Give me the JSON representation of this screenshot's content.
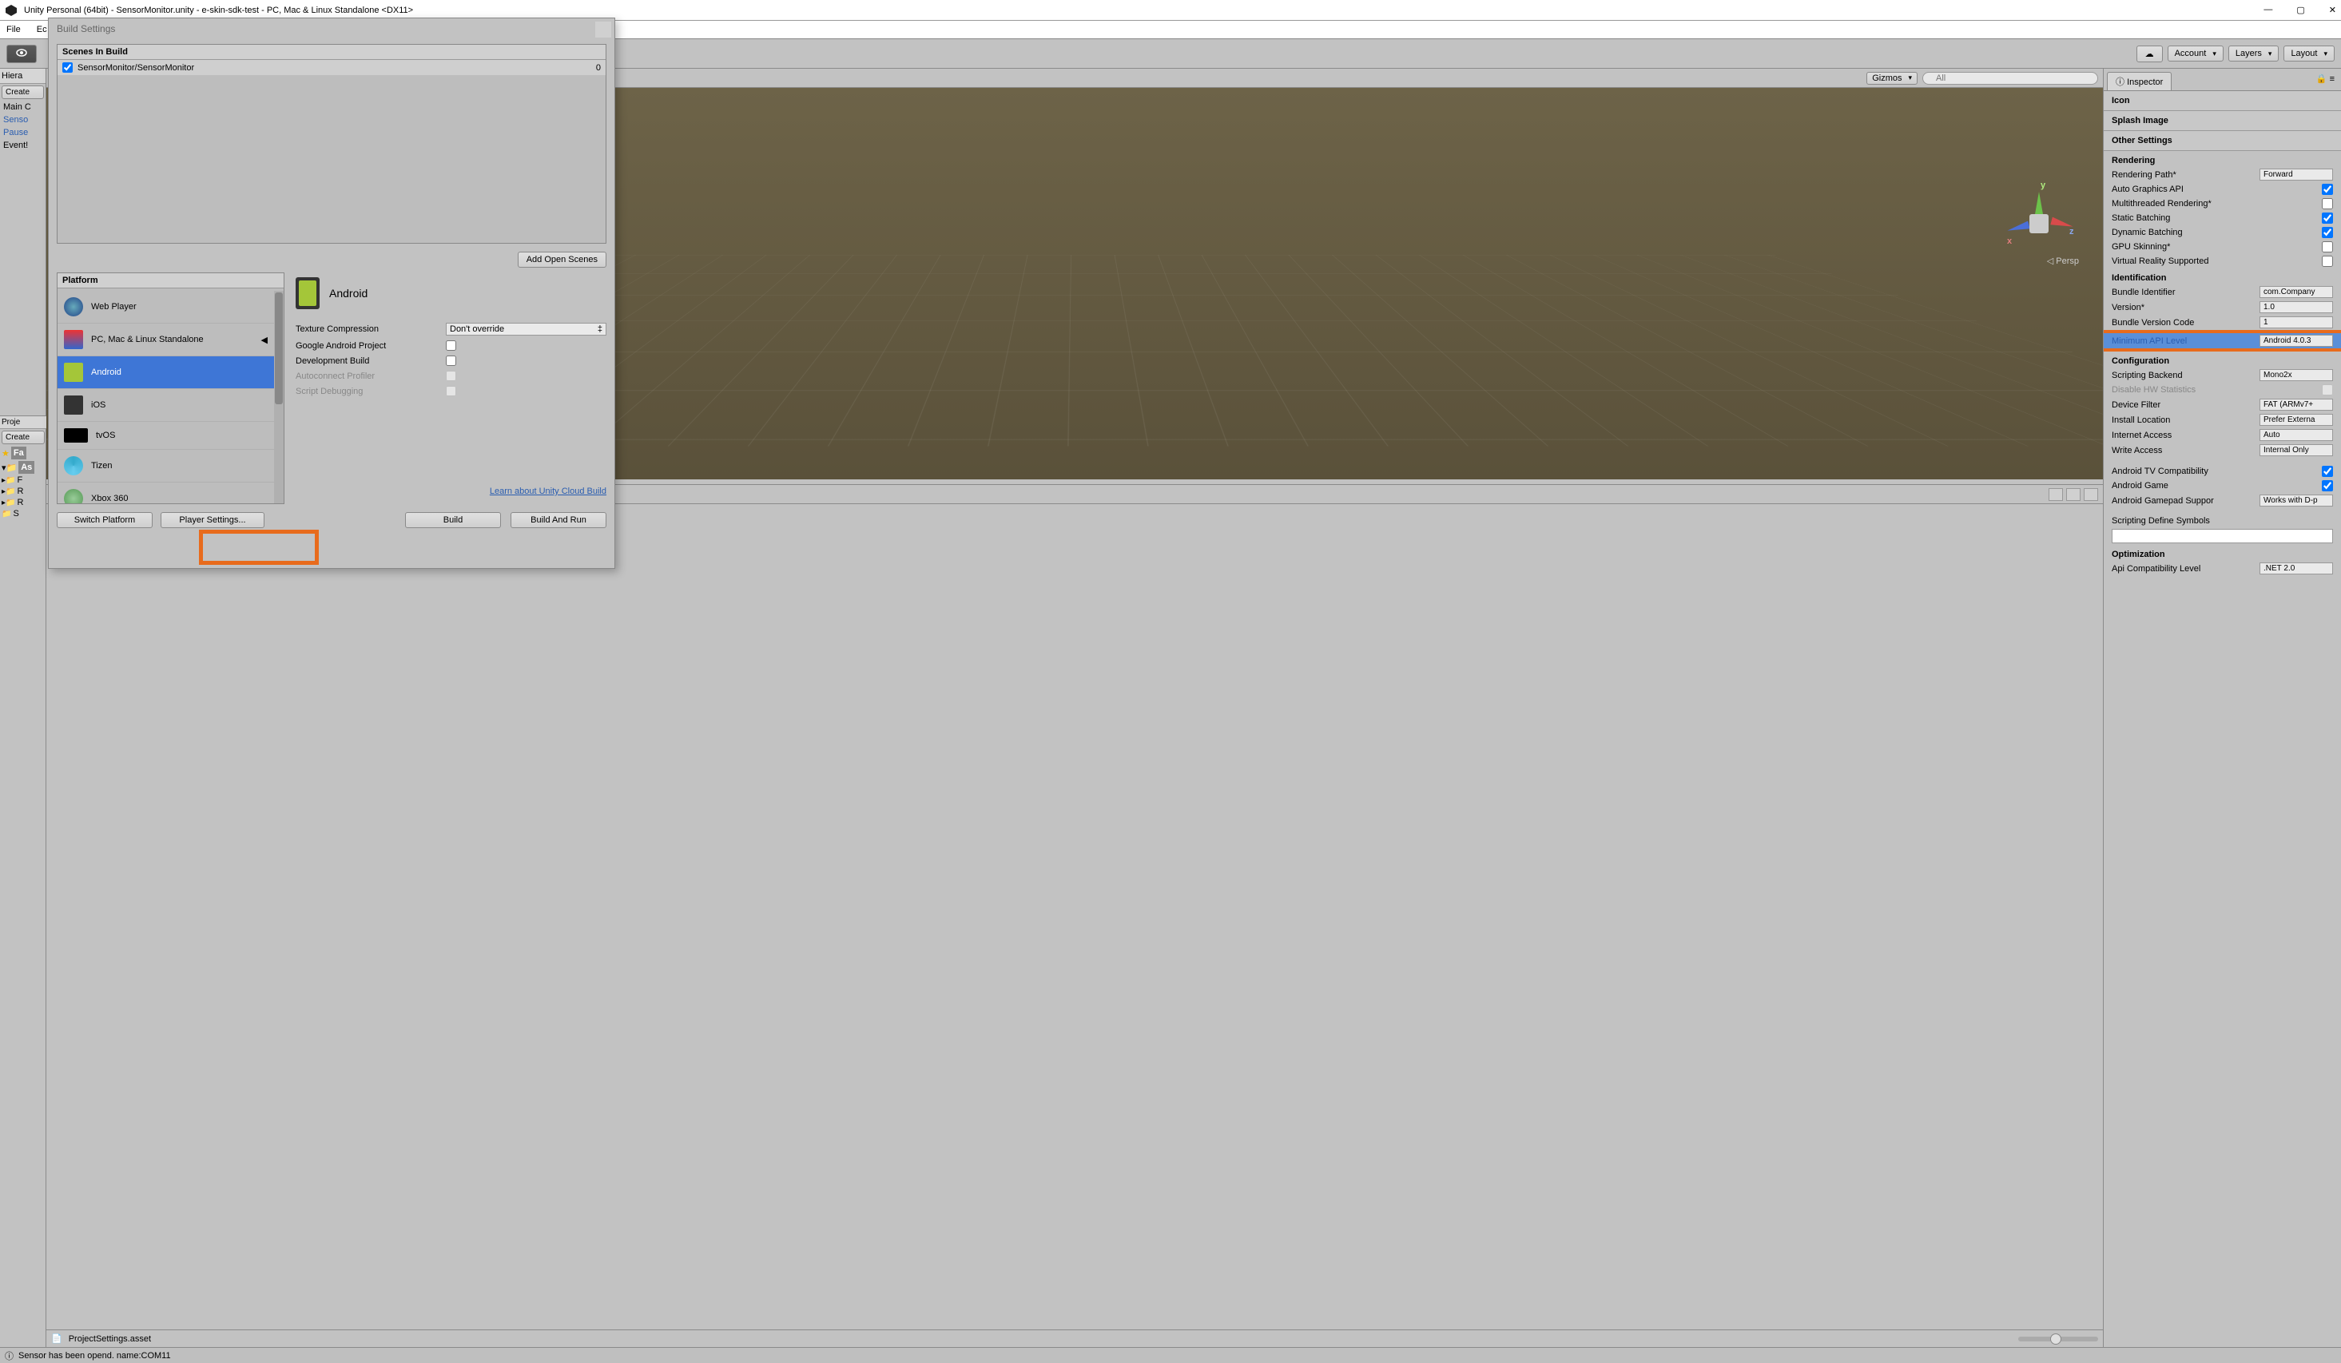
{
  "window": {
    "title": "Unity Personal (64bit) - SensorMonitor.unity - e-skin-sdk-test - PC, Mac & Linux Standalone <DX11>",
    "min": "—",
    "max": "▢",
    "close": "✕"
  },
  "menubar": {
    "file": "File",
    "edit": "Ec"
  },
  "toolbar": {
    "cloud": "☁",
    "account": "Account",
    "layers": "Layers",
    "layout": "Layout",
    "caret": "▾"
  },
  "hierarchy": {
    "title": "Hiera",
    "create": "Create",
    "items": [
      "Main C",
      "Senso",
      "Pause",
      "Event!"
    ]
  },
  "scene_toolbar": {
    "gizmos": "Gizmos",
    "search_placeholder": "All"
  },
  "scene": {
    "persp": "Persp",
    "y": "y",
    "x": "x",
    "z": "z"
  },
  "project_panel": {
    "proj": "Proje",
    "create": "Create",
    "fav": "Fa",
    "assets": "As",
    "rows": [
      "F",
      "R",
      "R",
      "S"
    ]
  },
  "footer": {
    "file": "ProjectSettings.asset"
  },
  "status": {
    "icon": "ⓘ",
    "text": "Sensor has been opend. name:COM11"
  },
  "cloud_build_link": "Learn about Unity Cloud Build",
  "build_dialog": {
    "title": "Build Settings",
    "scenes_header": "Scenes In Build",
    "scene0": "SensorMonitor/SensorMonitor",
    "scene0_idx": "0",
    "add_open_scenes": "Add Open Scenes",
    "platform_header": "Platform",
    "platforms": [
      "Web Player",
      "PC, Mac & Linux Standalone",
      "Android",
      "iOS",
      "tvOS",
      "Tizen",
      "Xbox 360"
    ],
    "selected_platform": "Android",
    "settings": {
      "tex_compression": "Texture Compression",
      "tex_compression_val": "Don't override",
      "google_android_project": "Google Android Project",
      "development_build": "Development Build",
      "autoconnect_profiler": "Autoconnect Profiler",
      "script_debugging": "Script Debugging"
    },
    "switch_platform": "Switch Platform",
    "player_settings": "Player Settings...",
    "build": "Build",
    "build_and_run": "Build And Run"
  },
  "inspector": {
    "tab": "Inspector",
    "sections": {
      "icon": "Icon",
      "splash": "Splash Image",
      "other": "Other Settings"
    },
    "rendering": {
      "header": "Rendering",
      "path": "Rendering Path*",
      "path_val": "Forward",
      "auto_gfx": "Auto Graphics API",
      "multithreaded": "Multithreaded Rendering*",
      "static_batch": "Static Batching",
      "dynamic_batch": "Dynamic Batching",
      "gpu_skin": "GPU Skinning*",
      "vr": "Virtual Reality Supported"
    },
    "identification": {
      "header": "Identification",
      "bundle_id": "Bundle Identifier",
      "bundle_id_val": "com.Company",
      "version": "Version*",
      "version_val": "1.0",
      "bundle_code": "Bundle Version Code",
      "bundle_code_val": "1",
      "min_api": "Minimum API Level",
      "min_api_val": "Android 4.0.3"
    },
    "configuration": {
      "header": "Configuration",
      "backend": "Scripting Backend",
      "backend_val": "Mono2x",
      "disable_hw": "Disable HW Statistics",
      "device_filter": "Device Filter",
      "device_filter_val": "FAT (ARMv7+",
      "install_loc": "Install Location",
      "install_loc_val": "Prefer Externa",
      "internet": "Internet Access",
      "internet_val": "Auto",
      "write": "Write Access",
      "write_val": "Internal Only",
      "tv_compat": "Android TV Compatibility",
      "android_game": "Android Game",
      "gamepad": "Android Gamepad Suppor",
      "gamepad_val": "Works with D-p",
      "define": "Scripting Define Symbols"
    },
    "optimization": {
      "header": "Optimization",
      "api_compat": "Api Compatibility Level",
      "api_compat_val": ".NET 2.0"
    }
  }
}
